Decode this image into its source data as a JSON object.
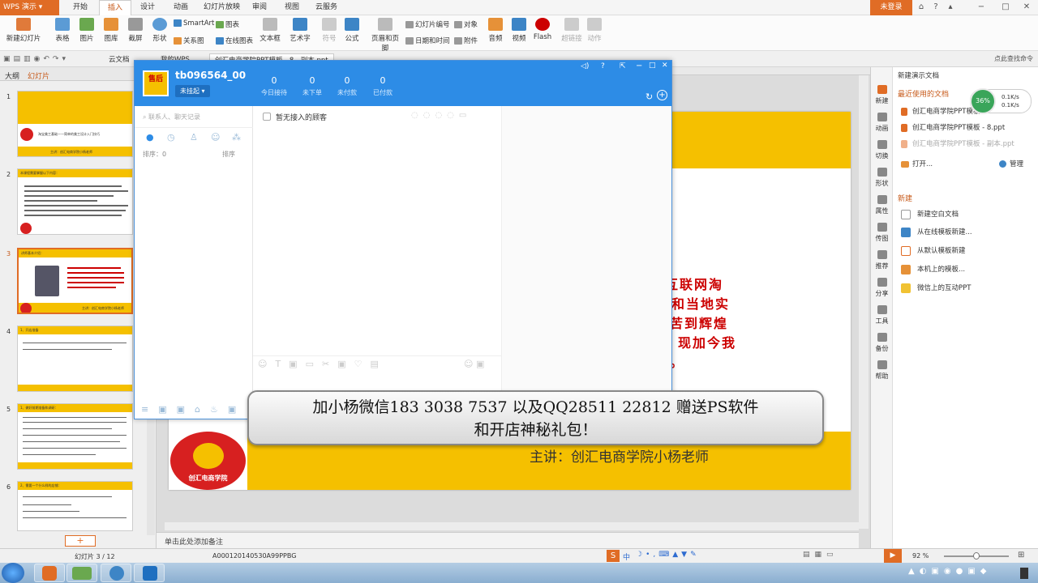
{
  "app": {
    "name": "WPS 演示",
    "ribbon_tabs": [
      "开始",
      "插入",
      "设计",
      "动画",
      "幻灯片放映",
      "审阅",
      "视图",
      "云服务"
    ],
    "active_tab": "插入",
    "login_label": "未登录"
  },
  "ribbon": {
    "new_slide": "新建幻灯片",
    "table": "表格",
    "picture": "图片",
    "gallery": "图库",
    "screenshot": "截屏",
    "shapes": "形状",
    "smartart": "SmartArt",
    "chart": "图表",
    "relation": "关系图",
    "online_chart": "在线图表",
    "textbox": "文本框",
    "arttext": "艺术字",
    "symbol": "符号",
    "formula": "公式",
    "header_footer": "页眉和页脚",
    "slide_number": "幻灯片编号",
    "object": "对象",
    "date_time": "日期和时间",
    "attachment": "附件",
    "audio": "音频",
    "video": "视频",
    "flash": "Flash",
    "hyperlink": "超链接",
    "action": "动作"
  },
  "doc_tabs": [
    "云文档",
    "我的WPS",
    "创汇电商学院PPT模板 - 8 - 副本.ppt"
  ],
  "quick_bar_right": "点此查找命令",
  "left_panel": {
    "tabs": [
      "大纲",
      "幻灯片"
    ],
    "slides": [
      {
        "num": "1",
        "title": "淘宝美工基础——简单的美工设计入门技巧",
        "footer": "主讲：创汇电商学院小杨老师"
      },
      {
        "num": "2",
        "title": "本课程需要掌握以下内容：",
        "footer": ""
      },
      {
        "num": "3",
        "title": "讲师基本介绍：",
        "footer": "主讲：创汇电商学院小杨老师"
      },
      {
        "num": "4",
        "title": "1、开店准备",
        "footer": ""
      },
      {
        "num": "5",
        "title": "1、做好前期准备和调研：",
        "footer": ""
      },
      {
        "num": "6",
        "title": "2、需要一个什么样的店铺：",
        "footer": ""
      }
    ],
    "add_label": "+"
  },
  "slide": {
    "red_lines": [
      "互联网淘",
      "和当地实",
      "苦到辉煌",
      "现加今我"
    ],
    "red_tail": "。",
    "logo_text": "创汇电商学院",
    "speaker": "主讲：创汇电商学院小杨老师",
    "notes_placeholder": "单击此处添加备注"
  },
  "chat_window": {
    "account": "tb096564_00",
    "status": "未挂起",
    "avatar_text": "售后",
    "stats": [
      {
        "value": "0",
        "label": "今日接待"
      },
      {
        "value": "0",
        "label": "未下单"
      },
      {
        "value": "0",
        "label": "未付款"
      },
      {
        "value": "0",
        "label": "已付款"
      }
    ],
    "search_placeholder": "联系人、聊天记录",
    "sort_left": "排序：0",
    "sort_right": "排序",
    "no_customer": "暂无接入的顾客"
  },
  "banner": {
    "line1": "加小杨微信183 3038 7537 以及QQ28511 22812 赠送PS软件",
    "line2": "和开店神秘礼包！"
  },
  "task_pane": {
    "title": "新建演示文档",
    "recent_heading": "最近使用的文档",
    "recent": [
      "创汇电商学院PPT模板",
      "创汇电商学院PPT模板 - 8.ppt",
      "创汇电商学院PPT模板 - 副本.ppt"
    ],
    "open": "打开...",
    "manage": "管理",
    "new_heading": "新建",
    "new_items": [
      "新建空白文档",
      "从在线模板新建...",
      "从默认模板新建",
      "本机上的模板...",
      "微信上的互动PPT"
    ],
    "side_buttons": [
      "新建",
      "动画",
      "切换",
      "形状",
      "属性",
      "传图",
      "推荐",
      "分享",
      "工具",
      "备份",
      "帮助"
    ],
    "net_percent": "36%",
    "net_up": "0.1K/s",
    "net_down": "0.1K/s"
  },
  "status": {
    "slide_counter": "幻灯片 3 / 12",
    "file_code": "A000120140530A99PPBG",
    "zoom": "92 %"
  },
  "tray": {
    "ime": "中"
  },
  "colors": {
    "accent_orange": "#e06c25",
    "slide_yellow": "#f5c000",
    "chat_blue": "#2d8ce6",
    "red_text": "#cc0000"
  }
}
